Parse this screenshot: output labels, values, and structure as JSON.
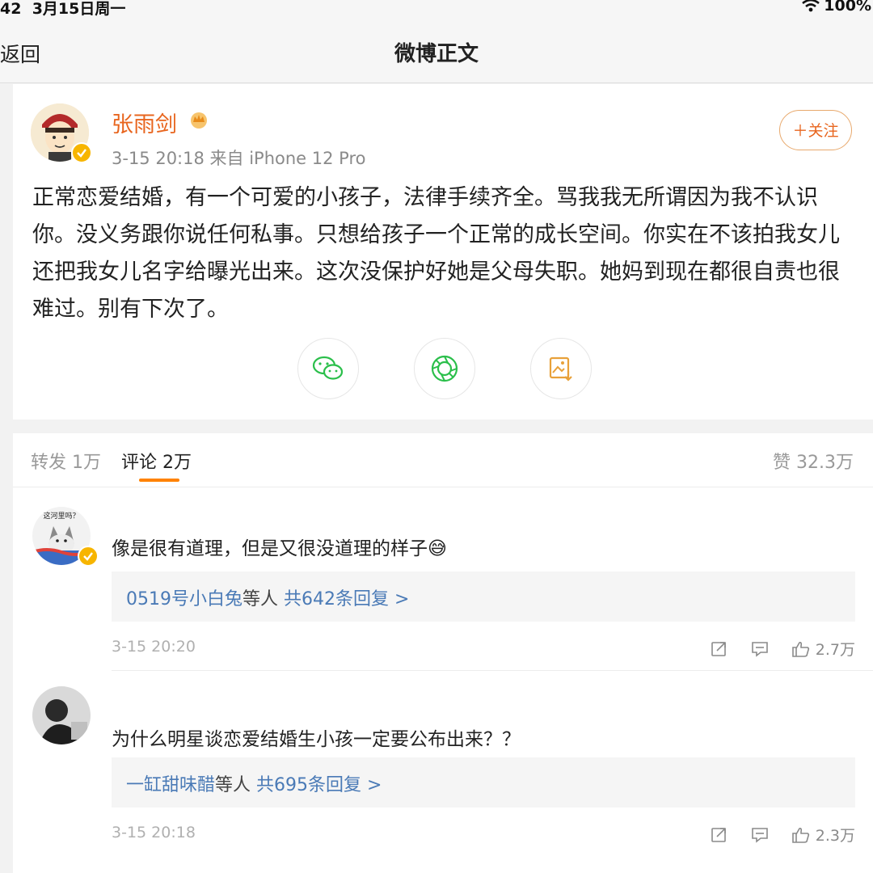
{
  "status_bar": {
    "time": "42",
    "date": "3月15日周一",
    "battery": "100%"
  },
  "nav": {
    "back_label": "返回",
    "title": "微博正文"
  },
  "post": {
    "author": "张雨剑",
    "meta": "3-15 20:18  来自 iPhone 12 Pro",
    "follow_label": "＋关注",
    "text": "正常恋爱结婚，有一个可爱的小孩子，法律手续齐全。骂我我无所谓因为我不认识你。没义务跟你说任何私事。只想给孩子一个正常的成长空间。你实在不该拍我女儿还把我女儿名字给曝光出来。这次没保护好她是父母失职。她妈到现在都很自责也很难过。别有下次了。",
    "share_icons": [
      "wechat-icon",
      "moments-icon",
      "save-image-icon"
    ]
  },
  "tabs": {
    "repost_label": "转发",
    "repost_count": "1万",
    "comment_label": "评论",
    "comment_count": "2万",
    "like_label": "赞",
    "like_count": "32.3万"
  },
  "comments": [
    {
      "avatar_caption": "这河里吗？",
      "text": "像是很有道理，但是又很没道理的样子😅",
      "reply_user": "0519号小白兔",
      "reply_mid": "等人",
      "reply_count_text": "共642条回复 >",
      "date": "3-15 20:20",
      "likes": "2.7万"
    },
    {
      "text": "为什么明星谈恋爱结婚生小孩一定要公布出来？？",
      "reply_user": "一缸甜味醋",
      "reply_mid": "等人",
      "reply_count_text": "共695条回复 >",
      "date": "3-15 20:18",
      "likes": "2.3万"
    }
  ],
  "colors": {
    "accent": "#e8651e",
    "link": "#4a7ab6",
    "tab_underline": "#ff8200",
    "verified": "#f7b500"
  }
}
